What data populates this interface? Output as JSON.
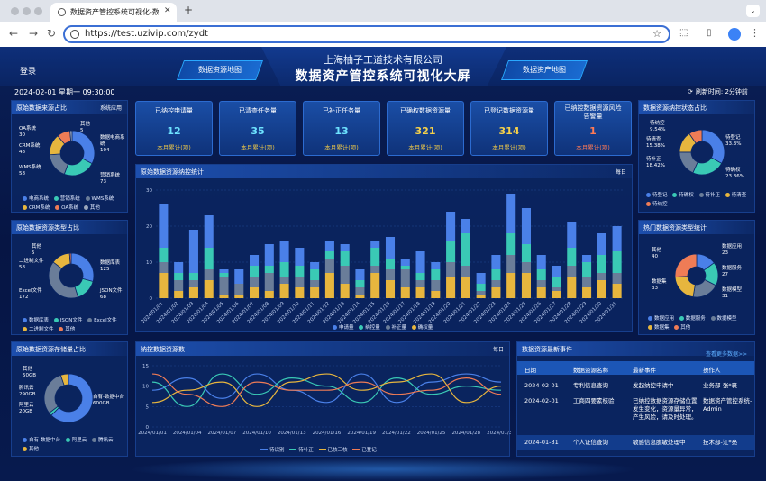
{
  "browser": {
    "tab_title": "数据资产管控系统可视化-数据...",
    "url": "https://test.uzivip.com/zydt"
  },
  "header": {
    "company": "上海柚子工道技术有限公司",
    "title": "数据资产管控系统可视化大屏",
    "login": "登录",
    "nav_left": "数据资源地图",
    "nav_right": "数据资产地图",
    "datetime": "2024-02-01 星期一 09:30:00",
    "refresh": "刷新时间: 2分钟前"
  },
  "colors": {
    "blue": "#4a80e8",
    "teal": "#3ac9b5",
    "gray": "#6a7d99",
    "gold": "#e7b63e",
    "orange": "#ef7c56",
    "red": "#e85c5c"
  },
  "source_pie": {
    "title": "原始数据来源占比",
    "subtitle": "系统应用",
    "labels": [
      {
        "name": "其他",
        "value": "5"
      },
      {
        "name": "OA系统",
        "value": "30"
      },
      {
        "name": "CRM系统",
        "value": "48"
      },
      {
        "name": "WMS系统",
        "value": "58"
      },
      {
        "name": "数据电商系统",
        "value": "104"
      },
      {
        "name": "营销系统",
        "value": "73"
      }
    ],
    "legend": [
      "电商系统",
      "营销系统",
      "WMS系统",
      "CRM系统",
      "OA系统",
      "其他"
    ]
  },
  "type_pie": {
    "title": "原始数据资源类型占比",
    "labels": [
      {
        "name": "其他",
        "value": "5"
      },
      {
        "name": "二进制文件",
        "value": "58"
      },
      {
        "name": "Excel文件",
        "value": "172"
      },
      {
        "name": "数据库表",
        "value": "125"
      },
      {
        "name": "JSON文件",
        "value": "68"
      }
    ],
    "legend": [
      "数据库表",
      "JSON文件",
      "Excel文件",
      "二进制文件",
      "其他"
    ]
  },
  "storage_pie": {
    "title": "原始数据资源存储量占比",
    "labels": [
      {
        "name": "其他",
        "value": "50GB"
      },
      {
        "name": "腾讯云",
        "value": "290GB"
      },
      {
        "name": "阿里云",
        "value": "20GB"
      },
      {
        "name": "自有-数据中台",
        "value": "600GB"
      }
    ],
    "legend": [
      "自有-数据中台",
      "阿里云",
      "腾讯云",
      "其他"
    ]
  },
  "stats": [
    {
      "label": "已纳控申请量",
      "value": "12",
      "sub": "本月累计(项)"
    },
    {
      "label": "已清查任务量",
      "value": "35",
      "sub": "本月累计(项)"
    },
    {
      "label": "已补正任务量",
      "value": "13",
      "sub": "本月累计(项)"
    },
    {
      "label": "已确权数据资源量",
      "value": "321",
      "sub": "本月累计(项)"
    },
    {
      "label": "已登记数据资源量",
      "value": "314",
      "sub": "本月累计(项)"
    },
    {
      "label": "已纳控数据资源风险告警量",
      "value": "1",
      "sub": "本月累计(项)"
    }
  ],
  "bar_chart": {
    "title": "原始数据资源纳控统计",
    "period": "每日",
    "legend": [
      "申请量",
      "纳控量",
      "补正量",
      "确权量"
    ]
  },
  "line_chart": {
    "title": "纳控数据资源数",
    "period": "每日",
    "legend": [
      "待识别",
      "待补正",
      "已核三核",
      "已登记"
    ]
  },
  "status_pie": {
    "title": "数据资源纳控状态占比",
    "labels": [
      {
        "name": "待纳控",
        "value": "9.54%"
      },
      {
        "name": "待清查",
        "value": "15.38%"
      },
      {
        "name": "待补正",
        "value": "18.42%"
      },
      {
        "name": "待登记",
        "value": "33.3%"
      },
      {
        "name": "待确权",
        "value": "23.36%"
      }
    ],
    "legend": [
      "待登记",
      "待确权",
      "待补正",
      "待清查",
      "待纳控"
    ]
  },
  "hot_pie": {
    "title": "热门数据资源类型统计",
    "labels": [
      {
        "name": "其他",
        "value": "40"
      },
      {
        "name": "数据集",
        "value": "33"
      },
      {
        "name": "数据应用",
        "value": "23"
      },
      {
        "name": "数据服务",
        "value": "27"
      },
      {
        "name": "数据模型",
        "value": "31"
      }
    ],
    "legend": [
      "数据应用",
      "数据服务",
      "数据模型",
      "数据集",
      "其他"
    ]
  },
  "events": {
    "title": "数据资源最新事件",
    "more": "查看更多数据>>",
    "headers": [
      "日期",
      "数据资源名称",
      "最新事件",
      "操作人"
    ],
    "rows": [
      {
        "date": "2024-02-01",
        "name": "专利信息查询",
        "event": "发起纳控申请中",
        "operator": "业务部-张*裹"
      },
      {
        "date": "2024-02-01",
        "name": "工商四要素核验",
        "event": "已纳控数据资源存储位置发生变化，资源量异常，产生风险，请及时处理。",
        "operator": "数据资产管控系统-Admin"
      },
      {
        "date": "2024-01-31",
        "name": "个人证信查询",
        "event": "敏感信息脱敏处理中",
        "operator": "技术部-江*亮"
      }
    ]
  },
  "chart_data": [
    {
      "type": "bar",
      "title": "原始数据资源纳控统计",
      "ylim": [
        0,
        30
      ],
      "yticks": [
        0,
        10,
        20,
        30
      ],
      "categories": [
        "2024/01/01",
        "2024/01/02",
        "2024/01/03",
        "2024/01/04",
        "2024/01/05",
        "2024/01/06",
        "2024/01/07",
        "2024/01/08",
        "2024/01/09",
        "2024/01/10",
        "2024/01/11",
        "2024/01/12",
        "2024/01/13",
        "2024/01/14",
        "2024/01/15",
        "2024/01/16",
        "2024/01/17",
        "2024/01/18",
        "2024/01/19",
        "2024/01/20",
        "2024/01/21",
        "2024/01/22",
        "2024/01/23",
        "2024/01/24",
        "2024/01/25",
        "2024/01/26",
        "2024/01/27",
        "2024/01/28",
        "2024/01/29",
        "2024/01/30",
        "2024/01/31"
      ],
      "series": [
        {
          "name": "确权量",
          "values": [
            7,
            2,
            3,
            5,
            1,
            1,
            3,
            2,
            4,
            3,
            3,
            7,
            4,
            1,
            7,
            5,
            3,
            3,
            2,
            6,
            6,
            1,
            3,
            7,
            7,
            3,
            2,
            6,
            3,
            5,
            4
          ]
        },
        {
          "name": "补正量",
          "values": [
            3,
            3,
            2,
            3,
            5,
            3,
            3,
            5,
            2,
            3,
            2,
            4,
            5,
            2,
            2,
            3,
            5,
            2,
            3,
            4,
            3,
            1,
            2,
            5,
            3,
            2,
            1,
            3,
            3,
            2,
            3
          ]
        },
        {
          "name": "纳控量",
          "values": [
            4,
            2,
            2,
            6,
            1,
            0,
            3,
            2,
            4,
            3,
            3,
            2,
            4,
            2,
            5,
            3,
            1,
            2,
            3,
            6,
            9,
            2,
            3,
            6,
            5,
            3,
            3,
            5,
            4,
            5,
            6
          ]
        },
        {
          "name": "申请量",
          "values": [
            12,
            3,
            12,
            9,
            1,
            4,
            3,
            6,
            6,
            5,
            2,
            3,
            2,
            3,
            2,
            6,
            2,
            6,
            2,
            8,
            4,
            3,
            4,
            11,
            10,
            4,
            3,
            7,
            2,
            6,
            7
          ]
        }
      ]
    },
    {
      "type": "line",
      "title": "纳控数据资源数",
      "ylim": [
        0,
        15
      ],
      "yticks": [
        0,
        5,
        10,
        15
      ],
      "x": [
        "2024/01/01",
        "2024/01/04",
        "2024/01/07",
        "2024/01/10",
        "2024/01/13",
        "2024/01/16",
        "2024/01/19",
        "2024/01/22",
        "2024/01/25",
        "2024/01/28",
        "2024/01/31"
      ],
      "series": [
        {
          "name": "待识别",
          "values": [
            9,
            12,
            7,
            13,
            9,
            6,
            13,
            6,
            11,
            13,
            11
          ]
        },
        {
          "name": "待补正",
          "values": [
            11,
            5,
            13,
            8,
            12,
            10,
            6,
            12,
            8,
            10,
            9
          ]
        },
        {
          "name": "已核三核",
          "values": [
            6,
            9,
            11,
            5,
            11,
            13,
            9,
            11,
            13,
            6,
            10
          ]
        },
        {
          "name": "已登记",
          "values": [
            13,
            8,
            5,
            11,
            9,
            9,
            11,
            8,
            9,
            12,
            8
          ]
        }
      ]
    }
  ]
}
